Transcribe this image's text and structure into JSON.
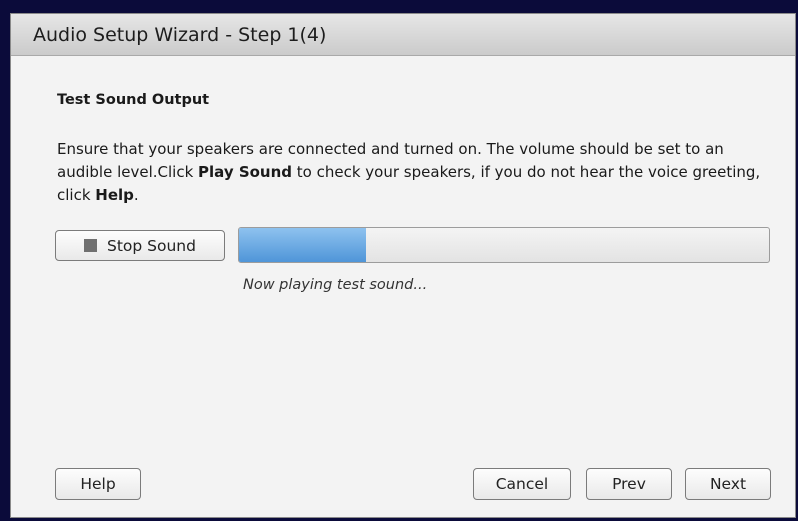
{
  "window": {
    "title": "Audio Setup Wizard - Step 1(4)"
  },
  "section": {
    "title": "Test Sound Output"
  },
  "instructions": {
    "part1": "Ensure that your speakers are connected and turned on. The volume should be set to an audible level.Click ",
    "bold1": "Play Sound",
    "part2": " to check your speakers, if you do not hear the voice greeting, click ",
    "bold2": "Help",
    "part3": "."
  },
  "playback": {
    "button_label": "Stop Sound",
    "button_icon": "stop-square-icon",
    "progress_fraction": 0.24,
    "status_text": "Now playing test sound..."
  },
  "footer": {
    "help_label": "Help",
    "cancel_label": "Cancel",
    "prev_label": "Prev",
    "next_label": "Next"
  },
  "colors": {
    "progress_fill": "#4f95d8",
    "background": "#0b0b3a",
    "dialog": "#f3f3f3"
  }
}
